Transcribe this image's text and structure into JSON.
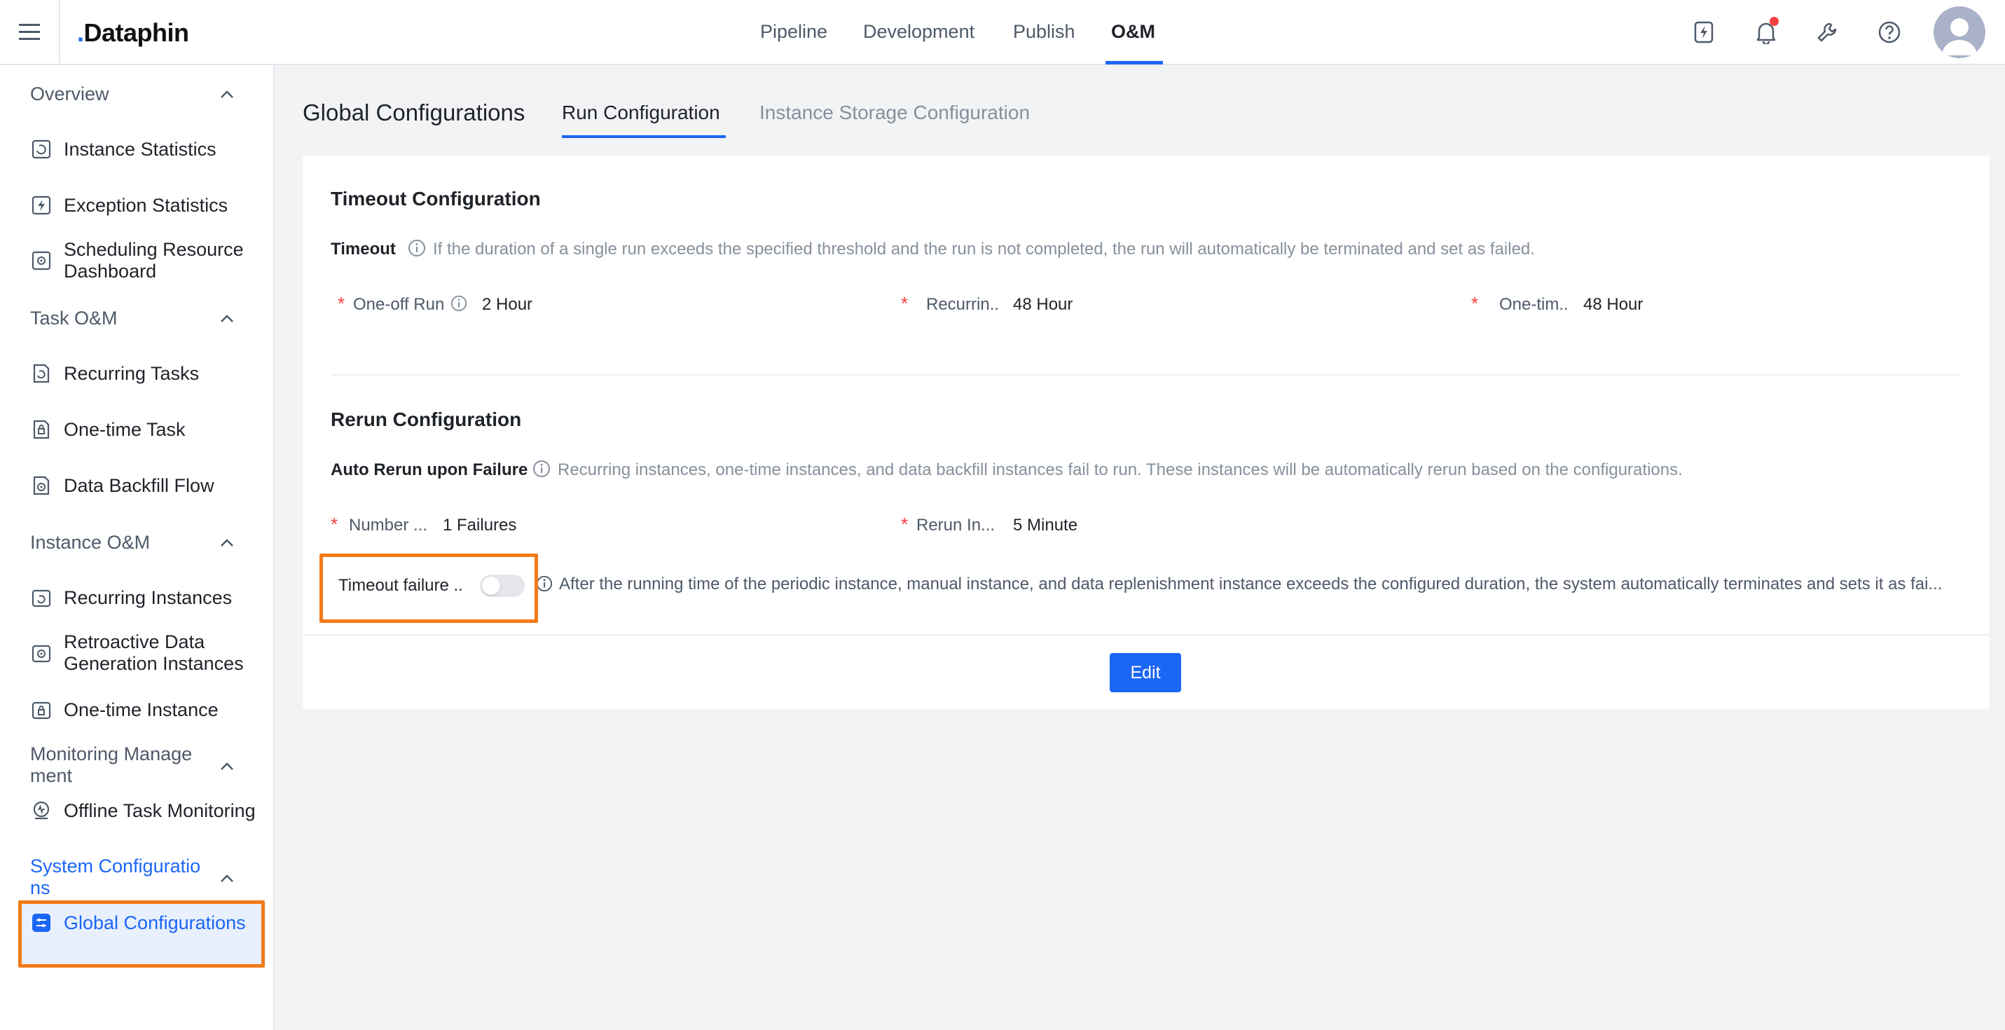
{
  "app": {
    "logo": "Dataphin"
  },
  "nav": {
    "pipeline": "Pipeline",
    "development": "Development",
    "publish": "Publish",
    "om": "O&M"
  },
  "sidebar": {
    "overview": "Overview",
    "instance_statistics": "Instance Statistics",
    "exception_statistics": "Exception Statistics",
    "scheduling_resource_dashboard": "Scheduling Resource Dashboard",
    "task_om": "Task O&M",
    "recurring_tasks": "Recurring Tasks",
    "one_time_task": "One-time Task",
    "data_backfill_flow": "Data Backfill Flow",
    "instance_om": "Instance O&M",
    "recurring_instances": "Recurring Instances",
    "retroactive": "Retroactive Data Generation Instances",
    "one_time_instance": "One-time Instance",
    "monitoring_management": "Monitoring Manage ment",
    "offline_task_monitoring": "Offline Task Monitoring",
    "system_configurations": "System Configuratio ns",
    "global_configurations": "Global Configurations"
  },
  "page": {
    "title": "Global Configurations",
    "tabs": {
      "run": "Run Configuration",
      "storage": "Instance Storage Configuration"
    }
  },
  "timeout": {
    "title": "Timeout Configuration",
    "label": "Timeout",
    "hint": "If the duration of a single run exceeds the specified threshold and the run is not completed, the run will automatically be terminated and set as failed.",
    "one_off_label": "One-off Run",
    "one_off_value": "2 Hour",
    "recurring_label": "Recurrin..",
    "recurring_value": "48 Hour",
    "one_time_label": "One-tim..",
    "one_time_value": "48 Hour"
  },
  "rerun": {
    "title": "Rerun Configuration",
    "label": "Auto Rerun upon Failure",
    "hint": "Recurring instances, one-time instances, and data backfill instances fail to run. These instances will be automatically rerun based on the configurations.",
    "number_label": "Number ...",
    "number_value": "1 Failures",
    "interval_label": "Rerun In...",
    "interval_value": "5 Minute",
    "timeout_failure_label": "Timeout failure ..",
    "timeout_failure_enabled": false,
    "timeout_failure_hint": "After the running time of the periodic instance, manual instance, and data replenishment instance exceeds the configured duration, the system automatically terminates and sets it as fai..."
  },
  "actions": {
    "edit": "Edit"
  },
  "colors": {
    "primary": "#1b66f5",
    "highlight": "#f27a18",
    "required": "#f53f3f"
  }
}
